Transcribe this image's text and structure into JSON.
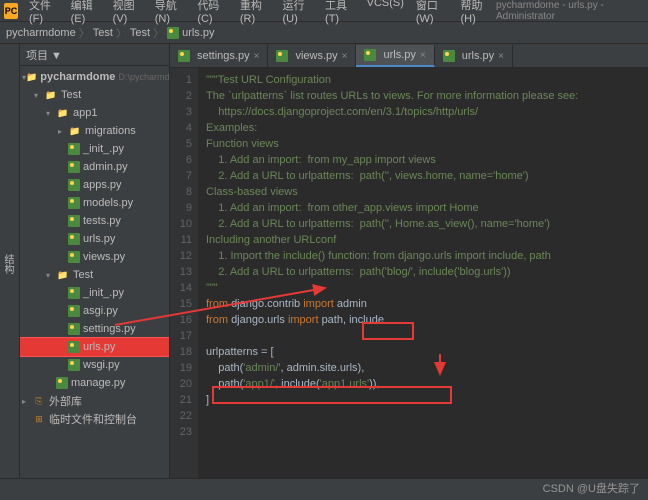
{
  "title": "pycharmdome - urls.py - Administrator",
  "logo": "PC",
  "menu": [
    "文件(F)",
    "编辑(E)",
    "视图(V)",
    "导航(N)",
    "代码(C)",
    "重构(R)",
    "运行(U)",
    "工具(T)",
    "VCS(S)",
    "窗口(W)",
    "帮助(H)"
  ],
  "breadcrumb": {
    "a": "pycharmdome",
    "b": "Test",
    "c": "Test",
    "file": "urls.py"
  },
  "project_label": "项目 ▼",
  "sidebar_tab": "结构",
  "tree": {
    "root": "pycharmdome",
    "root_path": "D:\\pycharmdome",
    "test": "Test",
    "app1": "app1",
    "migrations": "migrations",
    "init": "_init_.py",
    "admin": "admin.py",
    "apps": "apps.py",
    "models": "models.py",
    "tests": "tests.py",
    "urls1": "urls.py",
    "views": "views.py",
    "test2": "Test",
    "init2": "_init_.py",
    "asgi": "asgi.py",
    "settings": "settings.py",
    "urls2": "urls.py",
    "wsgi": "wsgi.py",
    "manage": "manage.py",
    "ext": "外部库",
    "scratch": "临时文件和控制台"
  },
  "tabs": [
    {
      "label": "settings.py",
      "active": false
    },
    {
      "label": "views.py",
      "active": false
    },
    {
      "label": "urls.py",
      "active": true
    },
    {
      "label": "urls.py",
      "active": false
    }
  ],
  "code": {
    "l1": "\"\"\"Test URL Configuration",
    "l2": "",
    "l3": "The `urlpatterns` list routes URLs to views. For more information please see:",
    "l4": "    https://docs.djangoproject.com/en/3.1/topics/http/urls/",
    "l5": "Examples:",
    "l6": "Function views",
    "l7": "    1. Add an import:  from my_app import views",
    "l8": "    2. Add a URL to urlpatterns:  path('', views.home, name='home')",
    "l9": "Class-based views",
    "l10": "    1. Add an import:  from other_app.views import Home",
    "l11": "    2. Add a URL to urlpatterns:  path('', Home.as_view(), name='home')",
    "l12": "Including another URLconf",
    "l13": "    1. Import the include() function: from django.urls import include, path",
    "l14": "    2. Add a URL to urlpatterns:  path('blog/', include('blog.urls'))",
    "l15": "\"\"\"",
    "l16a": "from ",
    "l16b": "django.contrib ",
    "l16c": "import ",
    "l16d": "admin",
    "l17a": "from ",
    "l17b": "django.urls ",
    "l17c": "import ",
    "l17d": "path",
    "l17e": ", ",
    "l17f": "include",
    "l19": "urlpatterns = [",
    "l20a": "    path(",
    "l20b": "'admin/'",
    "l20c": ", admin.site.urls),",
    "l21a": "    path(",
    "l21b": "'app1/'",
    "l21c": ", include(",
    "l21d": "'app1.urls'",
    "l21e": ")),",
    "l22": "]"
  },
  "watermark": "CSDN @U盘失踪了"
}
